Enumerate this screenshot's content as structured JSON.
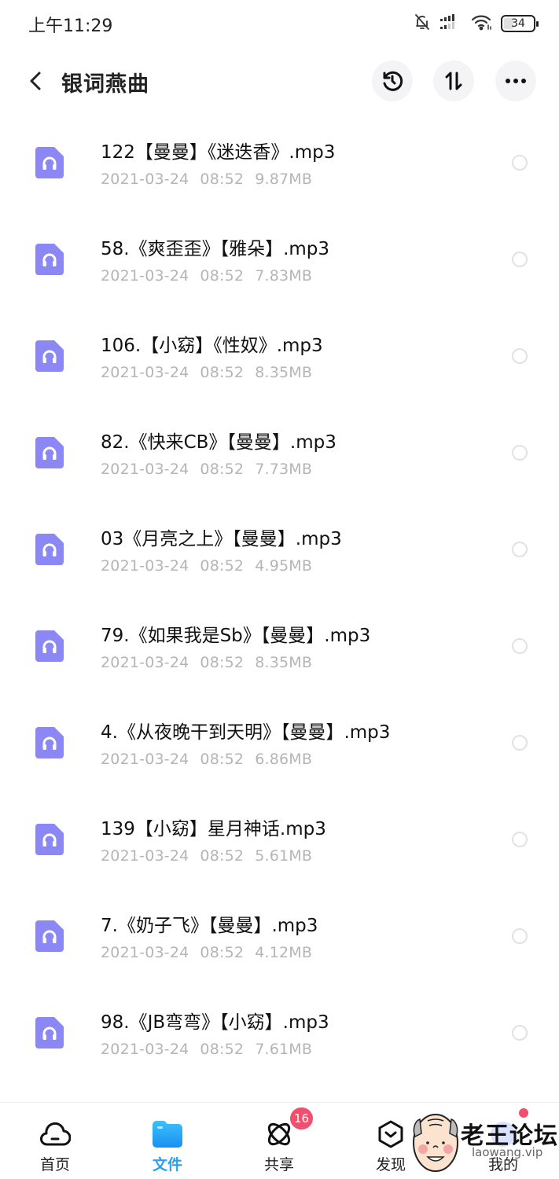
{
  "status_bar": {
    "time": "上午11:29",
    "battery_level": "34",
    "battery_percent": 34,
    "icons": [
      "bell-muted-icon",
      "signal-icon",
      "wifi-icon",
      "battery-icon"
    ]
  },
  "header": {
    "title": "银词燕曲",
    "back_icon": "chevron-left-icon",
    "actions": [
      {
        "name": "history",
        "icon": "history-icon"
      },
      {
        "name": "sort",
        "icon": "sort-icon"
      },
      {
        "name": "more",
        "icon": "more-icon"
      }
    ]
  },
  "files": [
    {
      "name": "122【曼曼】《迷迭香》.mp3",
      "date": "2021-03-24",
      "time": "08:52",
      "size": "9.87MB",
      "selected": false
    },
    {
      "name": "58.《爽歪歪》【雅朵】.mp3",
      "date": "2021-03-24",
      "time": "08:52",
      "size": "7.83MB",
      "selected": false
    },
    {
      "name": "106.【小窈】《性奴》.mp3",
      "date": "2021-03-24",
      "time": "08:52",
      "size": "8.35MB",
      "selected": false
    },
    {
      "name": "82.《快来CB》【曼曼】.mp3",
      "date": "2021-03-24",
      "time": "08:52",
      "size": "7.73MB",
      "selected": false
    },
    {
      "name": "03《月亮之上》【曼曼】.mp3",
      "date": "2021-03-24",
      "time": "08:52",
      "size": "4.95MB",
      "selected": false
    },
    {
      "name": "79.《如果我是Sb》【曼曼】.mp3",
      "date": "2021-03-24",
      "time": "08:52",
      "size": "8.35MB",
      "selected": false
    },
    {
      "name": "4.《从夜晚干到天明》【曼曼】.mp3",
      "date": "2021-03-24",
      "time": "08:52",
      "size": "6.86MB",
      "selected": false
    },
    {
      "name": "139【小窈】星月神话.mp3",
      "date": "2021-03-24",
      "time": "08:52",
      "size": "5.61MB",
      "selected": false
    },
    {
      "name": "7.《奶子飞》【曼曼】.mp3",
      "date": "2021-03-24",
      "time": "08:52",
      "size": "4.12MB",
      "selected": false
    },
    {
      "name": "98.《JB弯弯》【小窈】.mp3",
      "date": "2021-03-24",
      "time": "08:52",
      "size": "7.61MB",
      "selected": false
    }
  ],
  "file_icon": "audio-file-icon",
  "colors": {
    "accent": "#2b9ef0",
    "file_icon": "#8b87f5",
    "badge": "#f0506e",
    "meta_text": "#b5b5b5"
  },
  "bottom_nav": {
    "items": [
      {
        "key": "home",
        "label": "首页",
        "icon": "cloud-icon",
        "active": false
      },
      {
        "key": "files",
        "label": "文件",
        "icon": "folder-icon",
        "active": true
      },
      {
        "key": "share",
        "label": "共享",
        "icon": "orbit-icon",
        "active": false,
        "badge": "16"
      },
      {
        "key": "discover",
        "label": "发现",
        "icon": "discover-icon",
        "active": false
      },
      {
        "key": "mine",
        "label": "我的",
        "icon": "profile-icon",
        "active": false
      }
    ]
  },
  "watermark": {
    "title": "老王论坛",
    "url": "laowang.vip"
  }
}
